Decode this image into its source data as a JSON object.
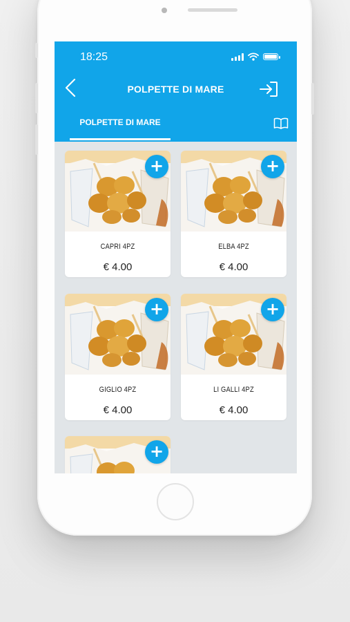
{
  "status_bar": {
    "time": "18:25"
  },
  "header": {
    "title": "POLPETTE DI MARE",
    "back_icon": "chevron-left-icon",
    "exit_icon": "log-in-icon",
    "menu_icon": "book-open-icon"
  },
  "tabs": [
    {
      "label": "POLPETTE DI MARE",
      "active": true
    }
  ],
  "products": [
    {
      "name": "CAPRI 4PZ",
      "price": "€ 4.00",
      "add_icon": "plus-icon",
      "add_label": "+"
    },
    {
      "name": "ELBA 4PZ",
      "price": "€ 4.00",
      "add_icon": "plus-icon",
      "add_label": "+"
    },
    {
      "name": "GIGLIO 4PZ",
      "price": "€ 4.00",
      "add_icon": "plus-icon",
      "add_label": "+"
    },
    {
      "name": "LI GALLI 4PZ",
      "price": "€ 4.00",
      "add_icon": "plus-icon",
      "add_label": "+"
    },
    {
      "name": "",
      "price": "",
      "add_icon": "plus-icon",
      "add_label": "+"
    }
  ],
  "colors": {
    "accent": "#11a5e9",
    "background": "#e1e5e8",
    "card": "#ffffff"
  }
}
